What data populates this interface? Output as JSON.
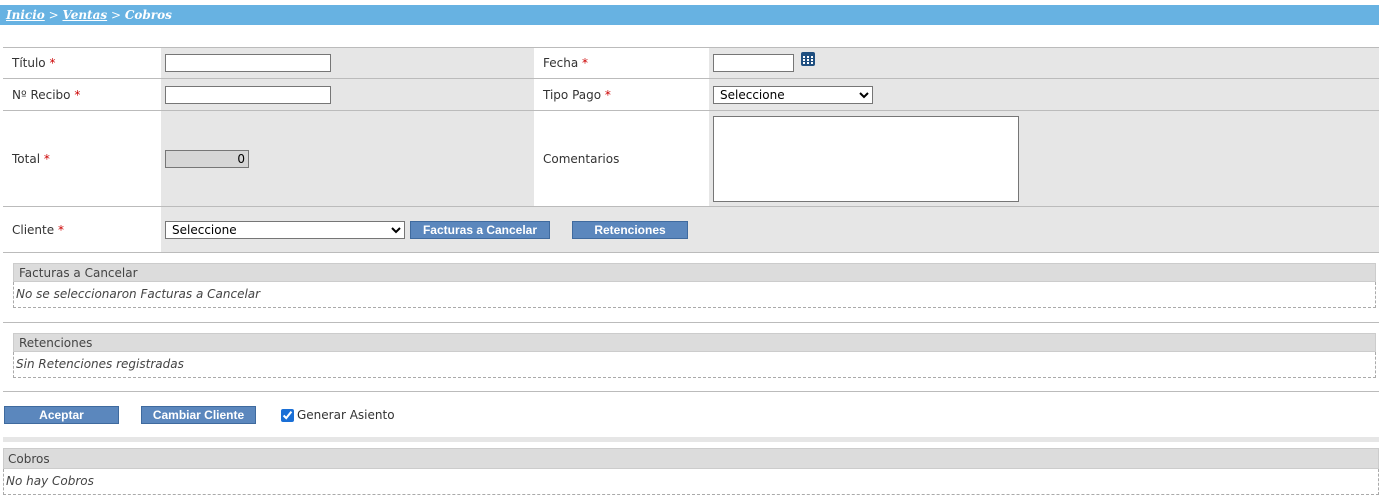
{
  "breadcrumb": {
    "inicio": "Inicio",
    "ventas": "Ventas",
    "separator": ">",
    "current": "Cobros"
  },
  "form": {
    "titulo": {
      "label": "Título",
      "required_mark": "*",
      "value": ""
    },
    "fecha": {
      "label": "Fecha",
      "required_mark": "*",
      "value": "",
      "icon": "calendar-icon"
    },
    "recibo": {
      "label": "Nº Recibo",
      "required_mark": "*",
      "value": ""
    },
    "tipo_pago": {
      "label": "Tipo Pago",
      "required_mark": "*",
      "selected": "Seleccione"
    },
    "total": {
      "label": "Total",
      "required_mark": "*",
      "value": "0"
    },
    "comentarios": {
      "label": "Comentarios",
      "value": ""
    },
    "cliente": {
      "label": "Cliente",
      "required_mark": "*",
      "selected": "Seleccione"
    },
    "facturas_button": "Facturas a Cancelar",
    "retenciones_button": "Retenciones"
  },
  "facturas_panel": {
    "title": "Facturas a Cancelar",
    "empty": "No se seleccionaron Facturas a Cancelar"
  },
  "retenciones_panel": {
    "title": "Retenciones",
    "empty": "Sin Retenciones registradas"
  },
  "actions": {
    "aceptar": "Aceptar",
    "cambiar_cliente": "Cambiar Cliente",
    "generar_asiento": "Generar Asiento",
    "generar_asiento_checked": true
  },
  "cobros_panel": {
    "title": "Cobros",
    "empty": "No hay Cobros"
  },
  "colors": {
    "breadcrumb_bg": "#67b2e2",
    "button_bg": "#5b87bd",
    "field_bg": "#e6e6e6"
  }
}
